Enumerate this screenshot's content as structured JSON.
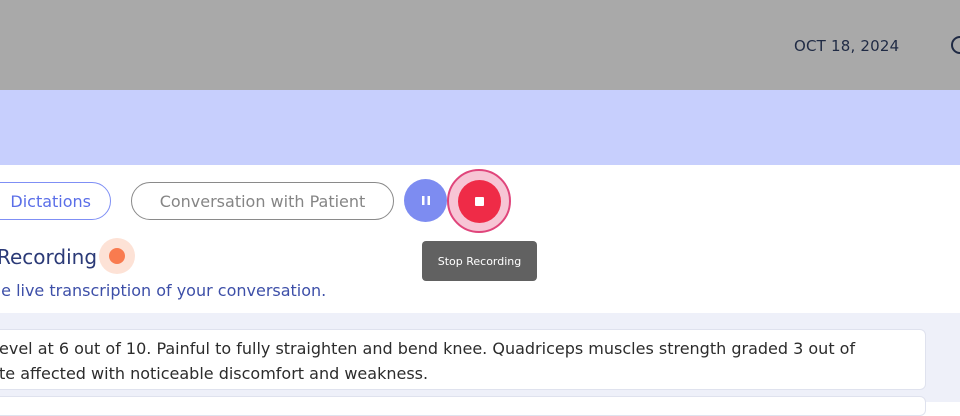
{
  "header": {
    "date": "OCT 18, 2024",
    "right_icon": "help-circle-icon"
  },
  "tabs": [
    {
      "label": "Dictations"
    },
    {
      "label": "Conversation with Patient"
    }
  ],
  "controls": {
    "pause_icon": "pause-icon",
    "stop_icon": "stop-icon",
    "stop_tooltip": "Stop Recording"
  },
  "recording": {
    "title": "Recording",
    "subtitle": "he live transcription of your conversation."
  },
  "transcript": {
    "line1": "evel at 6 out of 10. Painful to fully straighten and bend knee. Quadriceps muscles strength graded 3 out of",
    "line2": "te affected with noticeable discomfort and weakness."
  },
  "colors": {
    "accent": "#7d8cf1",
    "stop": "#ef2b47",
    "recording_dot": "#f97b4f",
    "band": "#c7cffd"
  }
}
